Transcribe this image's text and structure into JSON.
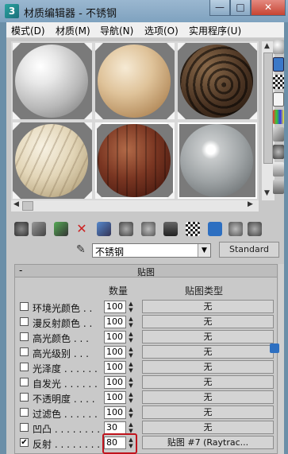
{
  "window": {
    "app_icon_letter": "3",
    "title": "材质编辑器 - 不锈钢",
    "minimize_glyph": "—",
    "maximize_glyph": "□",
    "close_glyph": "✕"
  },
  "menu": {
    "items": [
      "模式(D)",
      "材质(M)",
      "导航(N)",
      "选项(O)",
      "实用程序(U)"
    ]
  },
  "samples": {
    "slots": [
      {
        "material": "white-matte",
        "active": false
      },
      {
        "material": "light-wood",
        "active": false
      },
      {
        "material": "dark-pattern",
        "active": false
      },
      {
        "material": "marble",
        "active": false
      },
      {
        "material": "mahogany",
        "active": true
      },
      {
        "material": "stainless-steel",
        "active": true
      }
    ]
  },
  "material": {
    "name": "不锈钢",
    "type_button": "Standard"
  },
  "maps": {
    "rollout_title": "贴图",
    "collapse_glyph": "-",
    "col_amount": "数量",
    "col_map_type": "贴图类型",
    "rows": [
      {
        "label": "环境光颜色 . .",
        "amount": "100",
        "map": "无",
        "checked": false
      },
      {
        "label": "漫反射颜色 . .",
        "amount": "100",
        "map": "无",
        "checked": false
      },
      {
        "label": "高光颜色 . . .",
        "amount": "100",
        "map": "无",
        "checked": false
      },
      {
        "label": "高光级别 . . .",
        "amount": "100",
        "map": "无",
        "checked": false
      },
      {
        "label": "光泽度 . . . . . .",
        "amount": "100",
        "map": "无",
        "checked": false
      },
      {
        "label": "自发光 . . . . . .",
        "amount": "100",
        "map": "无",
        "checked": false
      },
      {
        "label": "不透明度 . . . .",
        "amount": "100",
        "map": "无",
        "checked": false
      },
      {
        "label": "过滤色 . . . . . .",
        "amount": "100",
        "map": "无",
        "checked": false
      },
      {
        "label": "凹凸 . . . . . . . .",
        "amount": "30",
        "map": "无",
        "checked": false
      },
      {
        "label": "反射 . . . . . . . .",
        "amount": "80",
        "map": "贴图 #7 (Raytrac...",
        "checked": true
      }
    ]
  },
  "colors": {
    "title_bar": "#8eabc6",
    "panel_bg": "#c8c8c8",
    "highlight_box": "#c0141c"
  }
}
